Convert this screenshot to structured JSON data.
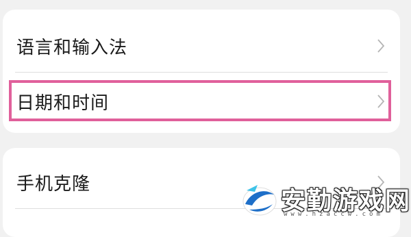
{
  "settings": {
    "items": [
      {
        "label": "语言和输入法",
        "icon": "chevron-right-icon"
      },
      {
        "label": "日期和时间",
        "icon": "chevron-right-icon",
        "highlighted": true
      },
      {
        "label": "手机克隆",
        "icon": "chevron-right-icon"
      }
    ]
  },
  "watermark": {
    "text": "安勤游戏网",
    "url": "www.hzaccw.com"
  },
  "colors": {
    "background": "#f1f1f1",
    "card": "#ffffff",
    "highlight": "#e0609b",
    "chevron": "#b5b5b5",
    "divider": "#dedede"
  }
}
